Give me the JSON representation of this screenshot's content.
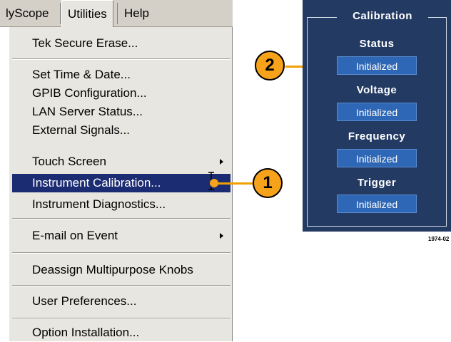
{
  "menubar": {
    "items": [
      {
        "label": "lyScope"
      },
      {
        "label": "Utilities"
      },
      {
        "label": "Help"
      }
    ]
  },
  "menu": {
    "items": [
      {
        "label": "Tek Secure Erase..."
      },
      {
        "label": "Set Time & Date..."
      },
      {
        "label": "GPIB Configuration..."
      },
      {
        "label": "LAN Server Status..."
      },
      {
        "label": "External Signals..."
      },
      {
        "label": "Touch Screen"
      },
      {
        "label": "Instrument Calibration..."
      },
      {
        "label": "Instrument Diagnostics..."
      },
      {
        "label": "E-mail on Event"
      },
      {
        "label": "Deassign Multipurpose Knobs"
      },
      {
        "label": "User Preferences..."
      },
      {
        "label": "Option Installation..."
      }
    ],
    "highlighted_index": 6
  },
  "callouts": {
    "one": "1",
    "two": "2"
  },
  "panel": {
    "title": "Calibration",
    "sections": [
      {
        "label": "Status",
        "value": "Initialized"
      },
      {
        "label": "Voltage",
        "value": "Initialized"
      },
      {
        "label": "Frequency",
        "value": "Initialized"
      },
      {
        "label": "Trigger",
        "value": "Initialized"
      }
    ]
  },
  "figure_number": "1974-02",
  "colors": {
    "menu_bg": "#e8e6e0",
    "highlight": "#1c2c72",
    "panel_bg": "#233a63",
    "button_bg": "#2e67b5",
    "callout": "#f7a21b"
  }
}
